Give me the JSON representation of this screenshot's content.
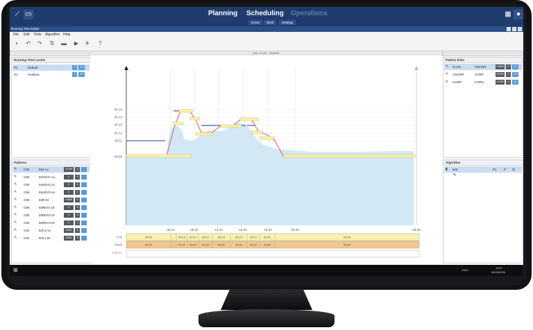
{
  "topbar": {
    "nav": [
      "Planning",
      "Scheduling",
      "Operations"
    ],
    "active": "Scheduling",
    "sub_tabs": [
      "Home",
      "Work",
      "Settings"
    ]
  },
  "window": {
    "title": "Running Time Editor"
  },
  "menu": [
    "File",
    "Edit",
    "Tools",
    "Algorithm",
    "Help"
  ],
  "toolbar": {
    "icons": [
      "save-icon",
      "undo-icon",
      "redo-icon",
      "swap-icon",
      "delete-icon",
      "play-icon",
      "run-icon",
      "help-icon"
    ],
    "help_label": "?"
  },
  "running_time_levels": {
    "title": "Running Time Levels",
    "rows": [
      {
        "code": "P1",
        "name": "Default",
        "a": "1",
        "b": "10"
      },
      {
        "code": "X1",
        "name": "Analysis",
        "a": "1",
        "b": "10"
      }
    ]
  },
  "patterns": {
    "title": "Patterns",
    "rows": [
      {
        "code": "C90",
        "name": "93A Ax",
        "a": "10780",
        "b": "5"
      },
      {
        "code": "C90",
        "name": "93ADV1 Ax",
        "a": "0",
        "b": "5"
      },
      {
        "code": "C90",
        "name": "93ADV2 Ax",
        "a": "0",
        "b": "5"
      },
      {
        "code": "C90",
        "name": "93ADV3 Ax",
        "a": "0",
        "b": "5"
      },
      {
        "code": "C90",
        "name": "93R Dr",
        "a": "10680",
        "b": "5"
      },
      {
        "code": "C90",
        "name": "93RDV1 Dr",
        "a": "0",
        "b": "5"
      },
      {
        "code": "C90",
        "name": "93RDV2 Dr",
        "a": "0",
        "b": "5"
      },
      {
        "code": "C90",
        "name": "93RDV3 Dr",
        "a": "0",
        "b": "5"
      },
      {
        "code": "C94",
        "name": "94A1 Ax",
        "a": "6424",
        "b": "5"
      },
      {
        "code": "C94",
        "name": "94A1 Dr",
        "a": "6336",
        "b": "5"
      }
    ]
  },
  "link_panel": {
    "title": "Link: CLSG - CMADR"
  },
  "pattern_links": {
    "title": "Pattern links",
    "rows": [
      {
        "from": "CLSG",
        "to": "CMADR",
        "a": "19680",
        "b": "5",
        "c": "10"
      },
      {
        "from": "CMADR",
        "to": "CODP",
        "a": "10780",
        "b": "5",
        "c": "10"
      },
      {
        "from": "CODP",
        "to": "CVRN",
        "a": "10780",
        "b": "5",
        "c": "10"
      }
    ]
  },
  "algorithm": {
    "title": "Algorithm",
    "rows": [
      {
        "name": "test",
        "p1": "P1",
        "p2": "P"
      }
    ]
  },
  "chart_data": {
    "type": "area",
    "y_ticks": [
      "00:09",
      "00:11",
      "00:12",
      "00:13",
      "00:14",
      "00:15"
    ],
    "x_ticks": [
      "06:15",
      "08:30",
      "13:30",
      "16:30",
      "18:30",
      "20:30",
      "06:59"
    ],
    "bands": {
      "link_label": "Link",
      "dwell_label": "Dwell",
      "pattern_label": "Pattern",
      "link": [
        "00:09",
        "...",
        "00:15",
        "00:14",
        "00:12",
        "00:13",
        "00:14",
        "00:12",
        "00:11",
        "00:09"
      ],
      "dwell": [
        "00:00",
        "...",
        "00:00",
        "00:00",
        "00:00",
        "00:00",
        "00:00",
        "00:00",
        "00:00",
        "00:00"
      ]
    },
    "colors": {
      "area": "#cde6f4",
      "line": "#e0565b",
      "blue": "#4a5fc1",
      "band": "#fbf0b0",
      "dwell": "#f5c78a"
    }
  },
  "taskbar": {
    "lang": "ENG",
    "time": "16:57",
    "date": "04/03/2020"
  }
}
